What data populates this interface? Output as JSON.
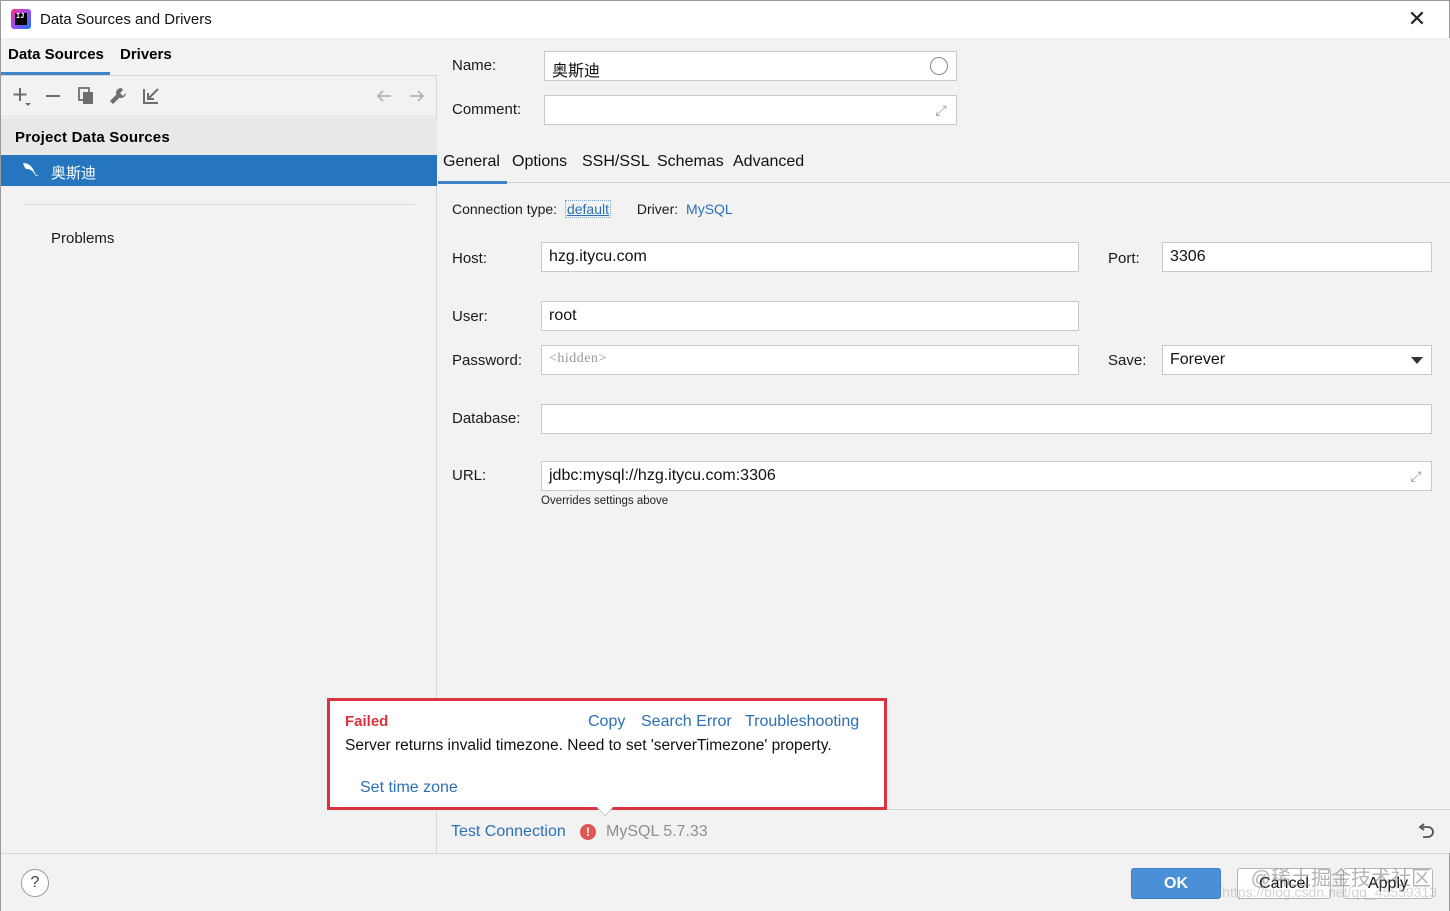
{
  "window": {
    "title": "Data Sources and Drivers",
    "close_glyph": "✕"
  },
  "left": {
    "tabs": [
      "Data Sources",
      "Drivers"
    ],
    "section_header": "Project Data Sources",
    "selected_source": "奥斯迪",
    "problems_label": "Problems"
  },
  "form": {
    "name_label": "Name:",
    "name_value": "奥斯迪",
    "comment_label": "Comment:",
    "comment_value": "",
    "tabs": [
      "General",
      "Options",
      "SSH/SSL",
      "Schemas",
      "Advanced"
    ],
    "connection_type_label": "Connection type:",
    "connection_type_value": "default",
    "driver_label": "Driver:",
    "driver_value": "MySQL",
    "host_label": "Host:",
    "host_value": "hzg.itycu.com",
    "port_label": "Port:",
    "port_value": "3306",
    "user_label": "User:",
    "user_value": "root",
    "password_label": "Password:",
    "password_placeholder": "<hidden>",
    "save_label": "Save:",
    "save_value": "Forever",
    "database_label": "Database:",
    "database_value": "",
    "url_label": "URL:",
    "url_value": "jdbc:mysql://hzg.itycu.com:3306",
    "url_note": "Overrides settings above"
  },
  "popup": {
    "status": "Failed",
    "actions": [
      "Copy",
      "Search Error",
      "Troubleshooting"
    ],
    "message": "Server returns invalid timezone. Need to set 'serverTimezone' property.",
    "fix_link": "Set time zone"
  },
  "test_bar": {
    "test_connection": "Test Connection",
    "version": "MySQL 5.7.33"
  },
  "footer": {
    "help": "?",
    "ok": "OK",
    "cancel": "Cancel",
    "apply": "Apply",
    "watermark": "@稀土掘金技术社区",
    "watermark_url": "https://blog.csdn.net/qq_45559313"
  },
  "colors": {
    "accent": "#4083c9",
    "selection": "#2675bf",
    "link": "#2b6fb6",
    "error": "#d9333f"
  }
}
